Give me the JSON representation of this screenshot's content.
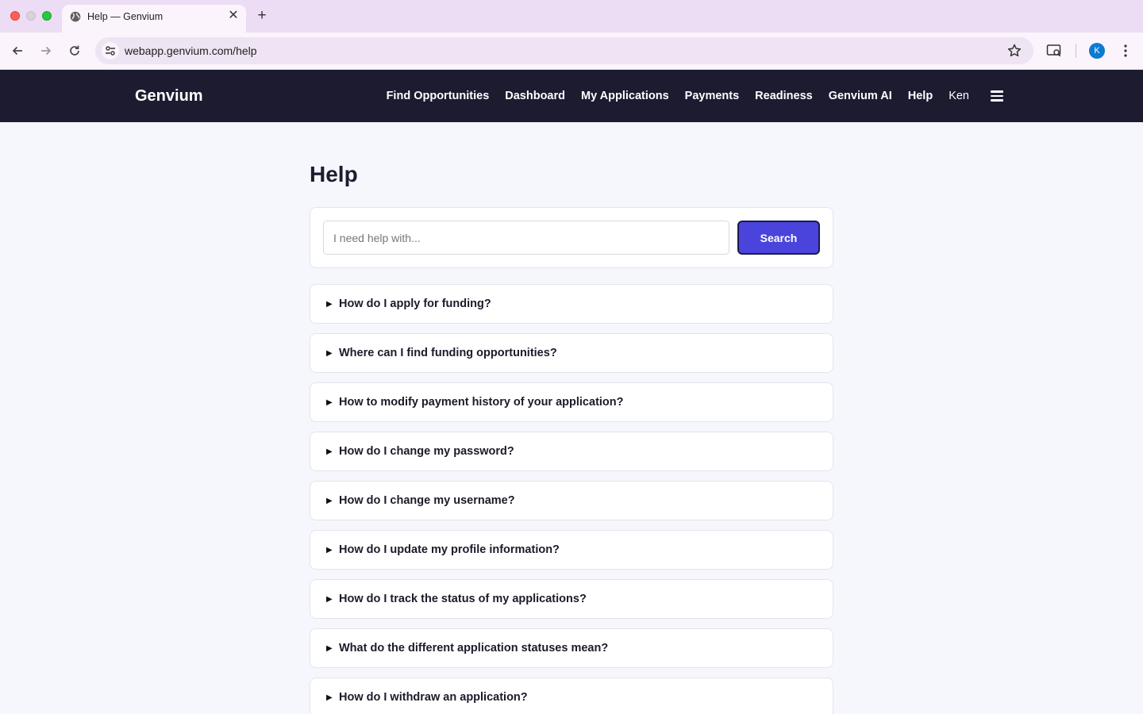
{
  "browser": {
    "tab_title": "Help — Genvium",
    "url": "webapp.genvium.com/help",
    "profile_initial": "K"
  },
  "site": {
    "brand": "Genvium",
    "nav": [
      "Find Opportunities",
      "Dashboard",
      "My Applications",
      "Payments",
      "Readiness",
      "Genvium AI",
      "Help"
    ],
    "user": "Ken"
  },
  "page": {
    "title": "Help",
    "search": {
      "placeholder": "I need help with...",
      "value": "",
      "button_label": "Search"
    },
    "faqs": [
      "How do I apply for funding?",
      "Where can I find funding opportunities?",
      "How to modify payment history of your application?",
      "How do I change my password?",
      "How do I change my username?",
      "How do I update my profile information?",
      "How do I track the status of my applications?",
      "What do the different application statuses mean?",
      "How do I withdraw an application?"
    ]
  },
  "colors": {
    "nav_background": "#1c1b30",
    "accent": "#4a44dc",
    "page_background": "#f6f7fc"
  }
}
